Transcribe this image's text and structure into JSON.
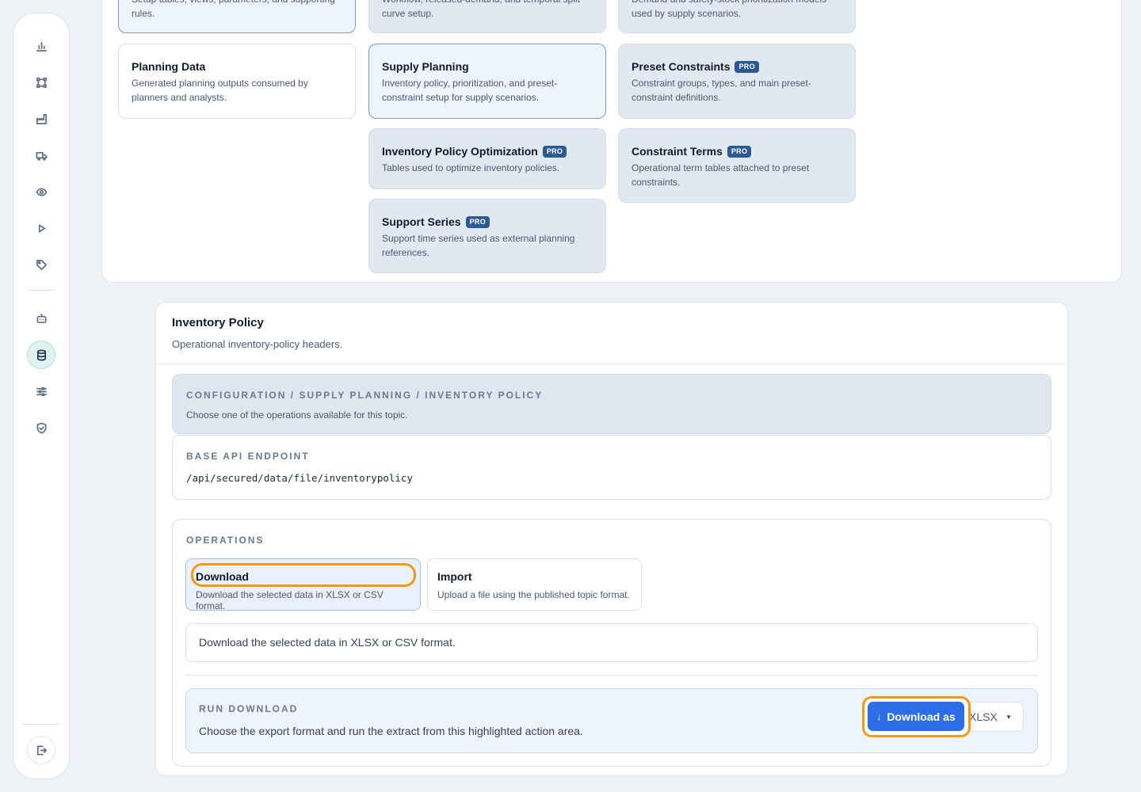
{
  "sidebar": {
    "icons": [
      "chart-icon",
      "flow-icon",
      "factory-icon",
      "truck-icon",
      "eye-icon",
      "play-icon",
      "tag-icon",
      "bot-icon",
      "database-icon",
      "sliders-icon",
      "shield-icon"
    ],
    "active": "database-icon",
    "logout_icon": "logout-icon"
  },
  "topics": {
    "cut_cards": [
      {
        "desc": "Setup tables, views, parameters, and supporting rules."
      },
      {
        "desc": "Workflow, released-demand, and temporal split curve setup."
      },
      {
        "desc": "Demand and safety-stock prioritization models used by supply scenarios."
      }
    ],
    "planning_data": {
      "title": "Planning Data",
      "desc": "Generated planning outputs consumed by planners and analysts."
    },
    "supply_planning": {
      "title": "Supply Planning",
      "desc": "Inventory policy, prioritization, and preset-constraint setup for supply scenarios."
    },
    "preset_constraints": {
      "title": "Preset Constraints",
      "badge": "PRO",
      "desc": "Constraint groups, types, and main preset-constraint definitions."
    },
    "inventory_policy_optimization": {
      "title": "Inventory Policy Optimization",
      "badge": "PRO",
      "desc": "Tables used to optimize inventory policies."
    },
    "constraint_terms": {
      "title": "Constraint Terms",
      "badge": "PRO",
      "desc": "Operational term tables attached to preset constraints."
    },
    "support_series": {
      "title": "Support Series",
      "badge": "PRO",
      "desc": "Support time series used as external planning references."
    }
  },
  "detail": {
    "title": "Inventory Policy",
    "subtitle": "Operational inventory-policy headers.",
    "breadcrumb": "CONFIGURATION / SUPPLY PLANNING / INVENTORY POLICY",
    "breadcrumb_hint": "Choose one of the operations available for this topic.",
    "endpoint_label": "BASE API ENDPOINT",
    "endpoint_value": "/api/secured/data/file/inventorypolicy",
    "operations_label": "OPERATIONS",
    "operations": [
      {
        "label": "Download",
        "desc": "Download the selected data in XLSX or CSV format."
      },
      {
        "label": "Import",
        "desc": "Upload a file using the published topic format."
      }
    ],
    "selected_desc": "Download the selected data in XLSX or CSV format.",
    "run_label": "RUN DOWNLOAD",
    "run_desc": "Choose the export format and run the extract from this highlighted action area.",
    "download_button": "Download as",
    "download_arrow": "↓",
    "format_value": "XLSX",
    "format_caret": "▼"
  },
  "colors": {
    "accent": "#2d6ee8",
    "highlight": "#f29a17",
    "pro_badge": "#2c5a93"
  }
}
